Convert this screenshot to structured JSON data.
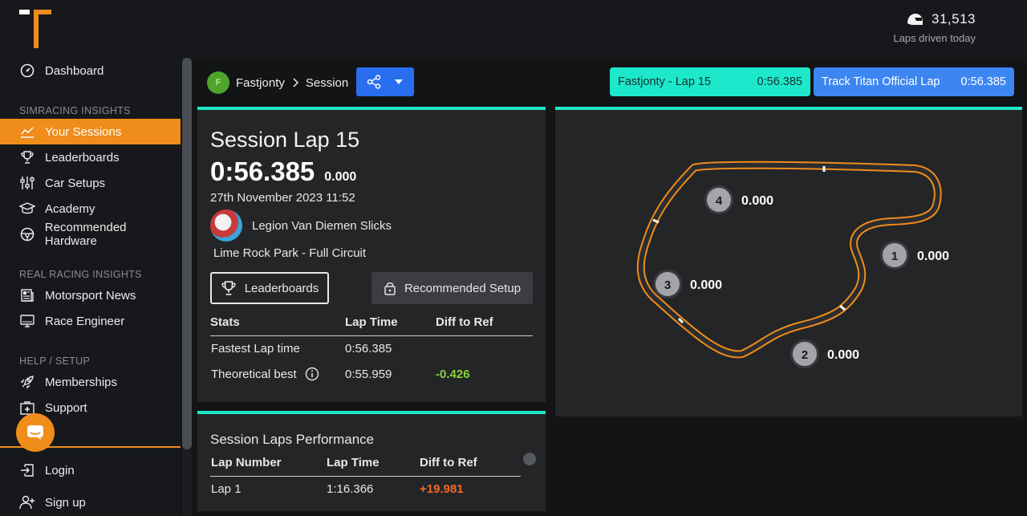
{
  "header": {
    "laps_count": "31,513",
    "laps_label": "Laps driven today"
  },
  "sidebar": {
    "dashboard": "Dashboard",
    "section_sim": "SIMRACING INSIGHTS",
    "sim_items": [
      "Your Sessions",
      "Leaderboards",
      "Car Setups",
      "Academy",
      "Recommended Hardware"
    ],
    "section_real": "REAL RACING INSIGHTS",
    "real_items": [
      "Motorsport News",
      "Race Engineer"
    ],
    "section_help": "HELP / SETUP",
    "help_items": [
      "Memberships",
      "Support"
    ],
    "login": "Login",
    "signup": "Sign up"
  },
  "breadcrumb": {
    "avatar_letter": "F",
    "user": "Fastjonty",
    "page": "Session"
  },
  "refs": {
    "lap_label": "Fastjonty - Lap 15",
    "lap_time": "0:56.385",
    "official_label": "Track Titan Official Lap",
    "official_time": "0:56.385"
  },
  "session": {
    "title": "Session Lap 15",
    "time": "0:56.385",
    "diff": "0.000",
    "date": "27th November 2023 11:52",
    "car": "Legion Van Diemen Slicks",
    "track": "Lime Rock Park - Full Circuit",
    "leaderboards_btn": "Leaderboards",
    "setup_btn": "Recommended Setup"
  },
  "stats": {
    "headers": [
      "Stats",
      "Lap Time",
      "Diff to Ref"
    ],
    "rows": [
      {
        "label": "Fastest Lap time",
        "time": "0:56.385",
        "diff": ""
      },
      {
        "label": "Theoretical best",
        "time": "0:55.959",
        "diff": "-0.426"
      }
    ]
  },
  "track_map": {
    "sectors": [
      {
        "num": "1",
        "value": "0.000"
      },
      {
        "num": "2",
        "value": "0.000"
      },
      {
        "num": "3",
        "value": "0.000"
      },
      {
        "num": "4",
        "value": "0.000"
      }
    ],
    "track_color": "#f08c1a"
  },
  "performance": {
    "title": "Session Laps Performance",
    "headers": [
      "Lap Number",
      "Lap Time",
      "Diff to Ref"
    ],
    "rows": [
      {
        "lap": "Lap 1",
        "time": "1:16.366",
        "diff": "+19.981"
      }
    ]
  },
  "colors": {
    "accent": "#f08c1a",
    "teal": "#1ee8cc",
    "blue": "#3d86f2",
    "positive": "#88d13b",
    "negative": "#f26a2a"
  }
}
